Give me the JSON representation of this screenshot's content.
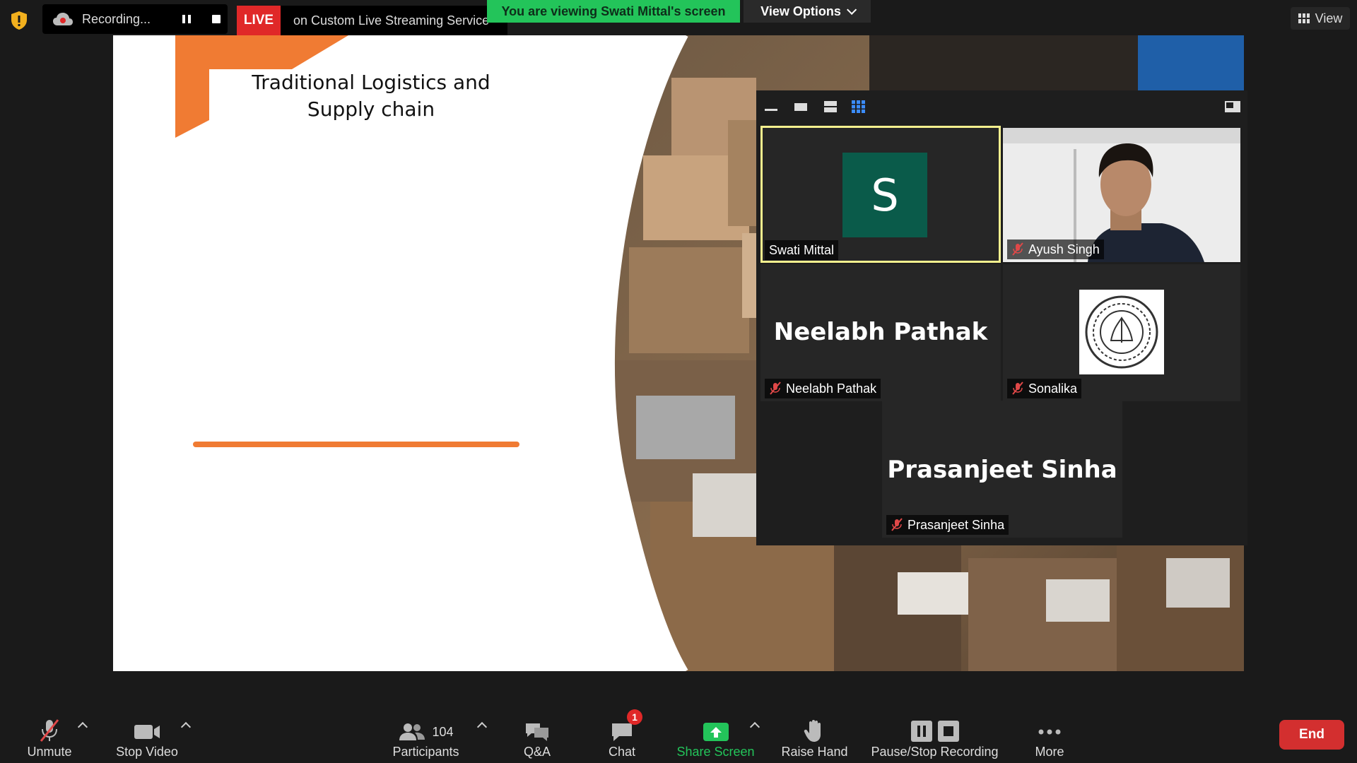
{
  "topbar": {
    "recording_text": "Recording...",
    "live_label": "LIVE",
    "live_service": "on Custom Live Streaming Service",
    "viewing_banner": "You are viewing Swati Mittal's screen",
    "view_options_label": "View Options",
    "view_label": "View"
  },
  "slide": {
    "title_line1": "Traditional Logistics and",
    "title_line2": "Supply chain",
    "accent_color": "#f07b33"
  },
  "gallery": {
    "tiles": [
      {
        "name": "Swati Mittal",
        "avatar_letter": "S",
        "muted": false,
        "active": true
      },
      {
        "name": "Ayush Singh",
        "muted": true
      },
      {
        "name": "Neelabh Pathak",
        "display_name": "Neelabh Pathak",
        "muted": true
      },
      {
        "name": "Sonalika",
        "muted": true
      },
      {
        "name": "Prasanjeet Sinha",
        "display_name": "Prasanjeet Sinha",
        "muted": true
      }
    ]
  },
  "toolbar": {
    "unmute": "Unmute",
    "stop_video": "Stop Video",
    "participants_label": "Participants",
    "participants_count": "104",
    "qa": "Q&A",
    "chat": "Chat",
    "chat_badge": "1",
    "share_screen": "Share Screen",
    "raise_hand": "Raise Hand",
    "pause_stop_recording": "Pause/Stop Recording",
    "more": "More",
    "end": "End",
    "share_color": "#23c45a",
    "end_color": "#d32f2f"
  }
}
